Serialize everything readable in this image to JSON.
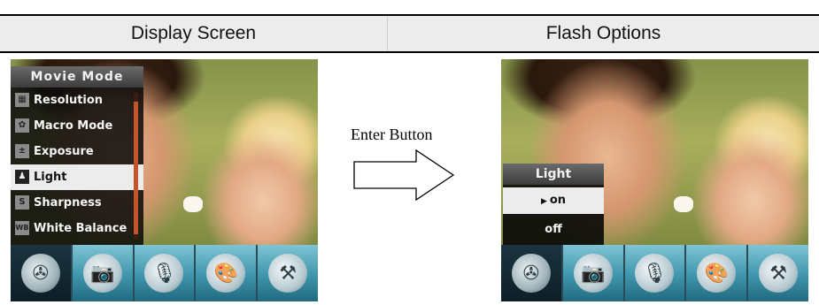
{
  "header": {
    "left_title": "Display Screen",
    "right_title": "Flash Options"
  },
  "transition": {
    "label": "Enter Button"
  },
  "left_screen": {
    "menu": {
      "title": "Movie Mode",
      "items": [
        {
          "label": "Resolution",
          "icon": "resolution-icon",
          "icon_glyph": "▦"
        },
        {
          "label": "Macro Mode",
          "icon": "macro-icon",
          "icon_glyph": "✿"
        },
        {
          "label": "Exposure",
          "icon": "exposure-icon",
          "icon_glyph": "±"
        },
        {
          "label": "Light",
          "icon": "light-icon",
          "icon_glyph": "♟",
          "selected": true
        },
        {
          "label": "Sharpness",
          "icon": "sharpness-icon",
          "icon_glyph": "S"
        },
        {
          "label": "White Balance",
          "icon": "white-balance-icon",
          "icon_glyph": "WB"
        }
      ]
    }
  },
  "right_screen": {
    "popup": {
      "title": "Light",
      "options": [
        {
          "label": "on",
          "selected": true
        },
        {
          "label": "off",
          "selected": false
        }
      ]
    }
  },
  "toolbar": {
    "tabs": [
      {
        "icon": "movie-reel-icon",
        "glyph": "✇",
        "selected": true
      },
      {
        "icon": "camera-icon",
        "glyph": "📷",
        "selected": false
      },
      {
        "icon": "microphone-icon",
        "glyph": "🎙",
        "selected": false
      },
      {
        "icon": "palette-icon",
        "glyph": "🎨",
        "selected": false
      },
      {
        "icon": "tools-icon",
        "glyph": "⚒",
        "selected": false
      }
    ]
  },
  "colors": {
    "header_bg": "#ececec",
    "toolbar_accent": "#3f95ab",
    "menu_bg": "#0a0a0a",
    "selected_row": "#ececec",
    "scrollbar": "#c4542a"
  }
}
